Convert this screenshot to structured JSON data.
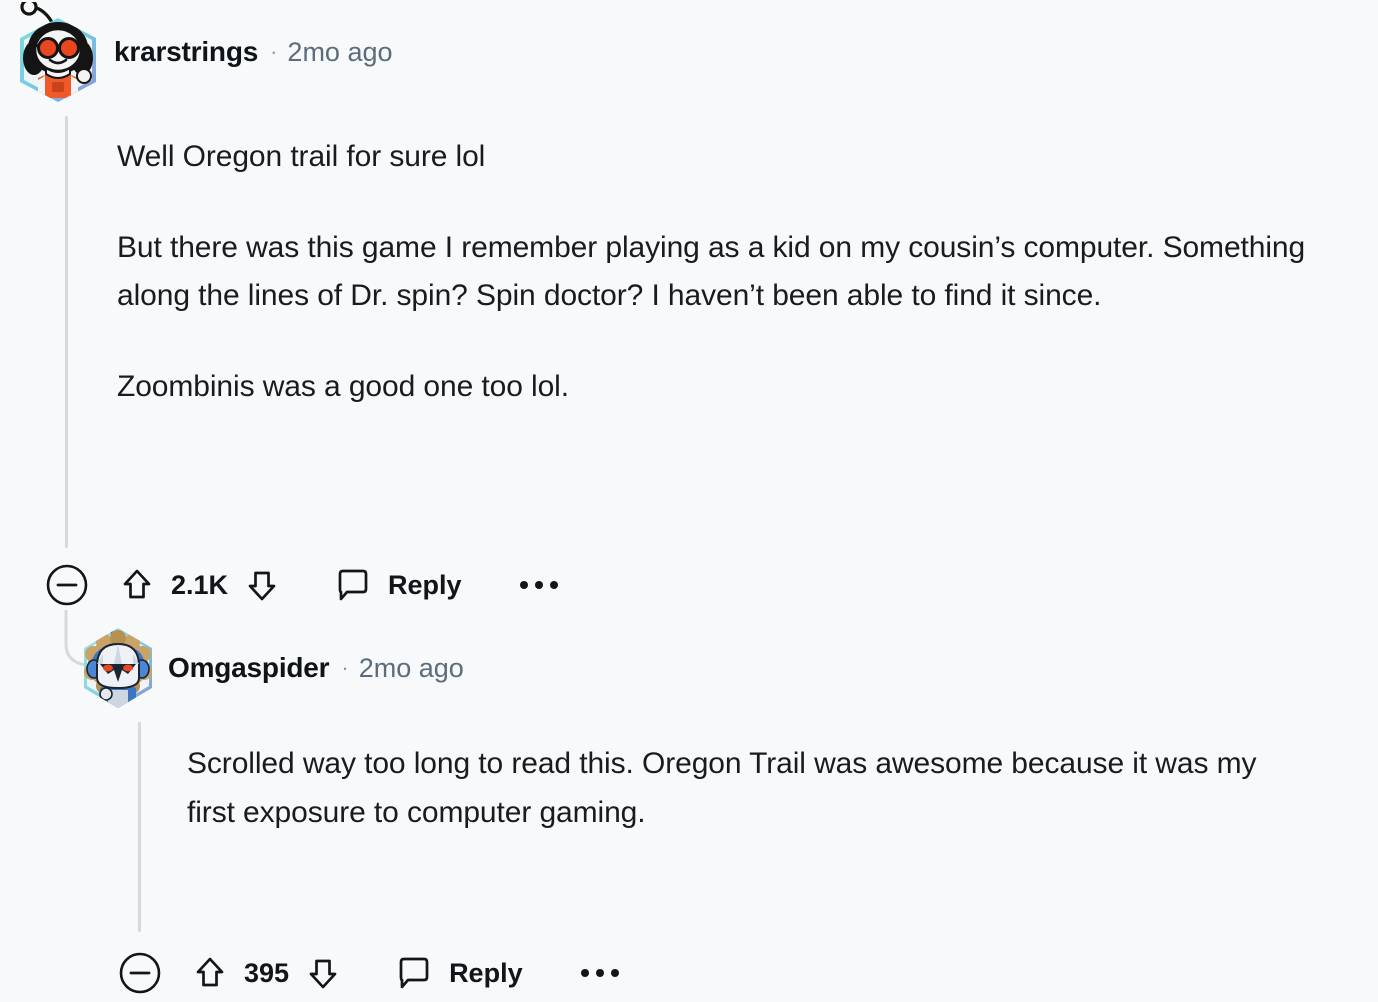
{
  "theme": {
    "background": "#f7f9fa",
    "text_primary": "#0f1419",
    "text_muted": "#5c6c7b",
    "threadline": "#d5dadd"
  },
  "comments": [
    {
      "id": "root-comment",
      "author": "krarstrings",
      "separator": "·",
      "timestamp": "2mo ago",
      "paragraphs": [
        "Well Oregon trail for sure lol",
        "But there was this game I remember playing as a kid on my cousin’s computer. Something along the lines of Dr. spin? Spin doctor? I haven’t been able to find it since.",
        "Zoombinis was a good one too lol."
      ],
      "actions": {
        "collapse_icon": "minus-circle-icon",
        "upvote_icon": "upvote-arrow-icon",
        "vote_count": "2.1K",
        "downvote_icon": "downvote-arrow-icon",
        "reply_icon": "comment-bubble-icon",
        "reply_label": "Reply",
        "more_icon": "more-horizontal-icon"
      },
      "avatar": {
        "name": "user-avatar-krarstrings",
        "description": "snoo-scientist-glasses-avatar",
        "frame_gradient_start": "#7ee0dd",
        "frame_gradient_end": "#8f8fd6",
        "hair_color": "#141414",
        "body_color": "#ef5a28",
        "skin_color": "#f2f2f2",
        "eye_color": "#e8471f"
      }
    },
    {
      "id": "reply-comment",
      "author": "Omgaspider",
      "separator": "·",
      "timestamp": "2mo ago",
      "paragraphs": [
        "Scrolled way too long to read this.  Oregon Trail was awesome because it was my first exposure to computer gaming."
      ],
      "actions": {
        "collapse_icon": "minus-circle-icon",
        "upvote_icon": "upvote-arrow-icon",
        "vote_count": "395",
        "downvote_icon": "downvote-arrow-icon",
        "reply_icon": "comment-bubble-icon",
        "reply_label": "Reply",
        "more_icon": "more-horizontal-icon"
      },
      "avatar": {
        "name": "user-avatar-omgaspider",
        "description": "snoo-mandalorian-helmet-avatar",
        "frame_gradient_start": "#7ee0dd",
        "frame_gradient_end": "#8f8fd6",
        "helmet_color": "#eef2f6",
        "armor_color": "#3f76c4",
        "collar_color": "#c9a367",
        "visor_color": "#1b2430",
        "eye_color": "#e8471f"
      }
    }
  ]
}
